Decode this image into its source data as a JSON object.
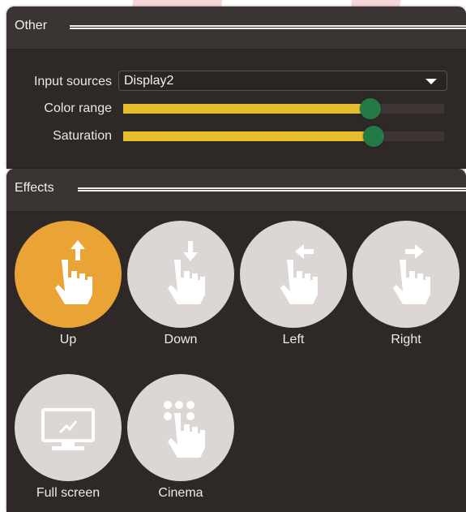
{
  "other": {
    "title": "Other",
    "input_sources": {
      "label": "Input sources",
      "value": "Display2"
    },
    "color_range": {
      "label": "Color range",
      "level": 0.77
    },
    "saturation": {
      "label": "Saturation",
      "level": 0.78
    }
  },
  "effects": {
    "title": "Effects",
    "items": [
      {
        "label": "Up",
        "icon": "hand-swipe-up-icon",
        "active": true
      },
      {
        "label": "Down",
        "icon": "hand-swipe-down-icon",
        "active": false
      },
      {
        "label": "Left",
        "icon": "hand-swipe-left-icon",
        "active": false
      },
      {
        "label": "Right",
        "icon": "hand-swipe-right-icon",
        "active": false
      },
      {
        "label": "Full screen",
        "icon": "monitor-icon",
        "active": false
      },
      {
        "label": "Cinema",
        "icon": "hand-tap-grid-icon",
        "active": false
      }
    ]
  },
  "colors": {
    "panel": "#2e2826",
    "header": "#3a3432",
    "slider_fill": "#e7bf2e",
    "slider_thumb": "#237a45",
    "active_effect": "#e9a435",
    "inactive_effect": "#dcd6d4"
  }
}
